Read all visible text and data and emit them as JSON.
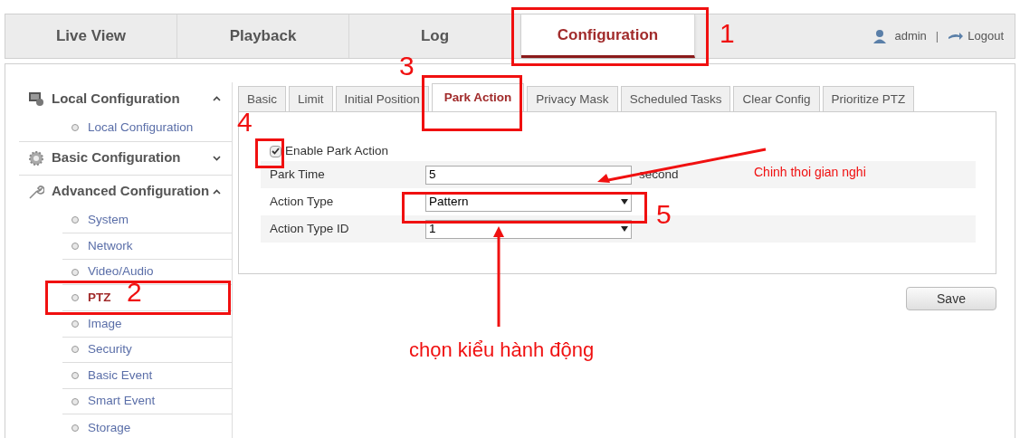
{
  "nav": {
    "tabs": [
      {
        "label": "Live View",
        "selected": false
      },
      {
        "label": "Playback",
        "selected": false
      },
      {
        "label": "Log",
        "selected": false
      },
      {
        "label": "Configuration",
        "selected": true
      }
    ],
    "user": "admin",
    "separator": "|",
    "logout": "Logout"
  },
  "sidebar": {
    "sections": [
      {
        "label": "Local Configuration",
        "kind": "monitor",
        "expanded": true,
        "items": [
          {
            "label": "Local Configuration",
            "selected": false
          }
        ]
      },
      {
        "label": "Basic Configuration",
        "kind": "gear",
        "expanded": false
      },
      {
        "label": "Advanced Configuration",
        "kind": "wrench",
        "expanded": true,
        "items": [
          {
            "label": "System",
            "selected": false
          },
          {
            "label": "Network",
            "selected": false
          },
          {
            "label": "Video/Audio",
            "selected": false
          },
          {
            "label": "PTZ",
            "selected": true
          },
          {
            "label": "Image",
            "selected": false
          },
          {
            "label": "Security",
            "selected": false
          },
          {
            "label": "Basic Event",
            "selected": false
          },
          {
            "label": "Smart Event",
            "selected": false
          },
          {
            "label": "Storage",
            "selected": false
          }
        ]
      }
    ]
  },
  "subtabs": [
    {
      "label": "Basic",
      "selected": false
    },
    {
      "label": "Limit",
      "selected": false
    },
    {
      "label": "Initial Position",
      "selected": false
    },
    {
      "label": "Park Action",
      "selected": true
    },
    {
      "label": "Privacy Mask",
      "selected": false
    },
    {
      "label": "Scheduled Tasks",
      "selected": false
    },
    {
      "label": "Clear Config",
      "selected": false
    },
    {
      "label": "Prioritize PTZ",
      "selected": false
    }
  ],
  "form": {
    "enable": {
      "label": "Enable Park Action",
      "checked": true
    },
    "rows": [
      {
        "kind": "text",
        "label": "Park Time",
        "value": "5",
        "unit": "second"
      },
      {
        "kind": "select",
        "label": "Action Type",
        "value": "Pattern"
      },
      {
        "kind": "select",
        "label": "Action Type ID",
        "value": "1"
      }
    ]
  },
  "save": "Save",
  "annotations": {
    "numbers": [
      "1",
      "2",
      "3",
      "4",
      "5"
    ],
    "notes": [
      "Chinh thoi gian nghi",
      "chọn kiểu hành động"
    ]
  }
}
